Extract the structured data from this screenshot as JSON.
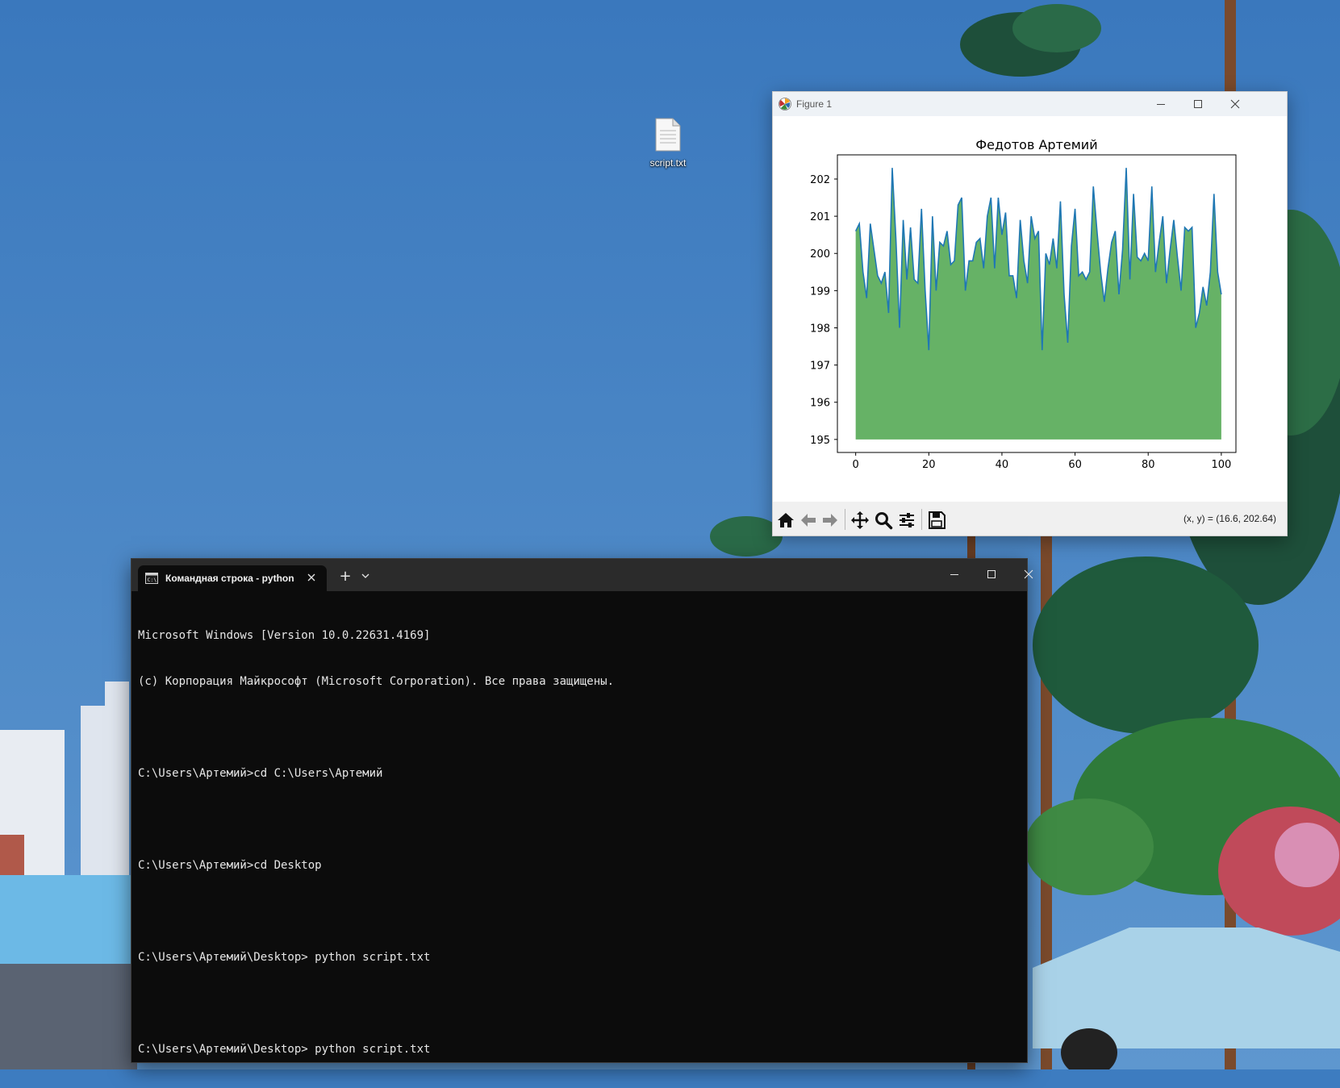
{
  "desktop": {
    "icons": [
      {
        "label": "script.txt",
        "icon": "text-file-icon"
      }
    ]
  },
  "figure_window": {
    "title": "Figure 1",
    "app_icon": "matplotlib-icon",
    "controls": [
      "minimize-icon",
      "maximize-icon",
      "close-icon"
    ],
    "toolbar": {
      "buttons": [
        "home-icon",
        "back-icon",
        "forward-icon",
        "pan-icon",
        "zoom-icon",
        "configure-subplots-icon",
        "save-icon"
      ],
      "coords_text": "(x, y) = (16.6, 202.64)"
    },
    "colors": {
      "fill": "#66b266",
      "line": "#1f77b4"
    }
  },
  "chart_data": {
    "type": "area",
    "title": "Федотов Артемий",
    "xlabel": "",
    "ylabel": "",
    "xlim": [
      -5,
      104
    ],
    "ylim": [
      194.65,
      202.65
    ],
    "xticks": [
      0,
      20,
      40,
      60,
      80,
      100
    ],
    "yticks": [
      195,
      196,
      197,
      198,
      199,
      200,
      201,
      202
    ],
    "fill_baseline": 195,
    "grid": false,
    "x_start": 0,
    "x_step": 1,
    "values": [
      200.6,
      200.8,
      199.5,
      198.8,
      200.8,
      200.1,
      199.4,
      199.2,
      199.5,
      198.4,
      202.3,
      200.4,
      198.0,
      200.9,
      199.3,
      200.7,
      199.3,
      199.2,
      201.2,
      199.0,
      197.4,
      201.0,
      199.0,
      200.3,
      200.2,
      200.6,
      199.7,
      199.8,
      201.3,
      201.5,
      199.0,
      199.8,
      199.8,
      200.3,
      200.4,
      199.6,
      201.0,
      201.5,
      199.6,
      201.5,
      200.5,
      201.1,
      199.4,
      199.4,
      198.8,
      200.9,
      199.8,
      199.2,
      201.0,
      200.4,
      200.6,
      197.4,
      200.0,
      199.7,
      200.4,
      199.6,
      201.4,
      198.9,
      197.6,
      200.2,
      201.2,
      199.4,
      199.5,
      199.3,
      199.5,
      201.8,
      200.6,
      199.5,
      198.7,
      199.6,
      200.3,
      200.6,
      198.9,
      200.1,
      202.3,
      199.3,
      201.6,
      199.9,
      199.8,
      200.0,
      199.8,
      201.8,
      199.5,
      200.3,
      201.0,
      199.2,
      200.1,
      200.9,
      199.9,
      199.0,
      200.7,
      200.6,
      200.7,
      198.0,
      198.4,
      199.1,
      198.6,
      199.5,
      201.6,
      199.5,
      198.9
    ]
  },
  "terminal": {
    "tab_title": "Командная строка - python",
    "tab_icon": "cmd-icon",
    "new_tab_label": "+",
    "lines": [
      "Microsoft Windows [Version 10.0.22631.4169]",
      "(c) Корпорация Майкрософт (Microsoft Corporation). Все права защищены.",
      "",
      "C:\\Users\\Артемий>cd C:\\Users\\Артемий",
      "",
      "C:\\Users\\Артемий>cd Desktop",
      "",
      "C:\\Users\\Артемий\\Desktop> python script.txt",
      "",
      "C:\\Users\\Артемий\\Desktop> python script.txt"
    ]
  }
}
